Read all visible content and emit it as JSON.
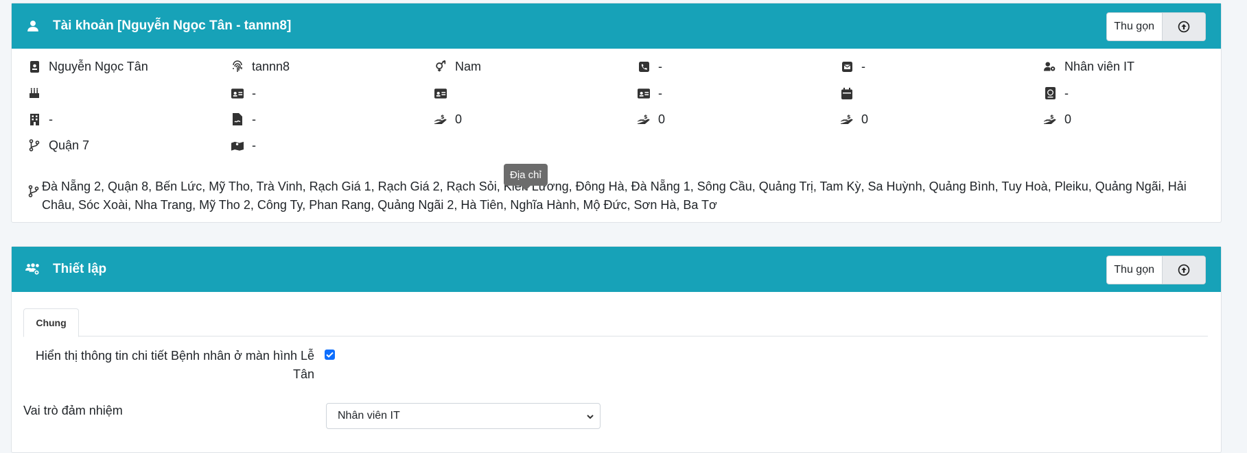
{
  "account": {
    "title": "Tài khoản [Nguyễn Ngọc Tân - tannn8]",
    "collapse_label": "Thu gọn",
    "row1": {
      "fullname": "Nguyễn Ngọc Tân",
      "username": "tannn8",
      "gender": "Nam",
      "phone": "-",
      "email": "-",
      "role": "Nhân viên IT"
    },
    "row2": {
      "birthday": "",
      "id_card": "-",
      "id_card2": "",
      "id_card3": "-",
      "date": "",
      "passport": "-"
    },
    "row3": {
      "building": "-",
      "document": "-",
      "salary1": "0",
      "salary2": "0",
      "salary3": "0",
      "salary4": "0"
    },
    "row4": {
      "branch": "Quận 7",
      "map": "-"
    },
    "branches": "Đà Nẵng 2, Quận 8, Bến Lức, Mỹ Tho, Trà Vinh, Rạch Giá 1, Rạch Giá 2, Rạch Sỏi, Kiên Lương, Đông Hà, Đà Nẵng 1, Sông Cầu, Quảng Trị, Tam Kỳ, Sa Huỳnh, Quảng Bình, Tuy Hoà, Pleiku, Quảng Ngãi, Hải Châu, Sóc Xoài, Nha Trang, Mỹ Tho 2, Công Ty, Phan Rang, Quảng Ngãi 2, Hà Tiên, Nghĩa Hành, Mộ Đức, Sơn Hà, Ba Tơ",
    "tooltip": "Địa chỉ"
  },
  "settings": {
    "title": "Thiết lập",
    "collapse_label": "Thu gọn",
    "tab_general": "Chung",
    "show_patient_detail_label": "Hiển thị thông tin chi tiết Bệnh nhân ở màn hình Lễ Tân",
    "show_patient_detail_checked": true,
    "role_label": "Vai trò đảm nhiệm",
    "role_value": "Nhân viên IT"
  },
  "colors": {
    "header": "#17a2b8",
    "checkbox": "#0d6efd"
  }
}
